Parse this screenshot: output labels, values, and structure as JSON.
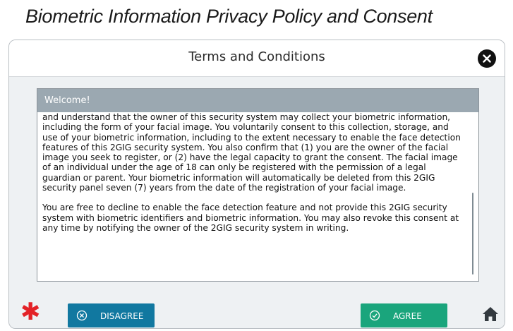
{
  "page": {
    "heading": "Biometric Information Privacy Policy and Consent"
  },
  "dialog": {
    "title": "Terms and Conditions",
    "close_icon": "close-icon"
  },
  "terms": {
    "welcome": "Welcome!",
    "paragraphs": [
      "and understand that the owner of this security system may collect your biometric information, including the form of your facial image.  You voluntarily consent to this collection, storage, and use of your biometric information, including to the extent necessary to enable the face detection features of this 2GIG security system.  You also confirm that (1) you are the owner of the facial image you seek to register, or (2) have the legal capacity to grant the consent.  The facial image of an individual under the age of 18 can only be registered with the permission of a legal guardian or parent.  Your biometric information will automatically be deleted from this 2GIG security panel seven (7) years from the date of the registration of your facial image.",
      "You are free to decline to enable the face detection feature and not provide this 2GIG security system with biometric identifiers and biometric information.  You may also revoke this consent at any time by notifying the owner of the 2GIG security system in writing."
    ]
  },
  "footer": {
    "emergency_icon": "asterisk-icon",
    "disagree_label": "DISAGREE",
    "agree_label": "AGREE",
    "home_icon": "home-icon"
  },
  "colors": {
    "disagree": "#1178a0",
    "agree": "#1aa57c",
    "emergency": "#e32227",
    "welcome_bar": "#9ba8b1"
  }
}
